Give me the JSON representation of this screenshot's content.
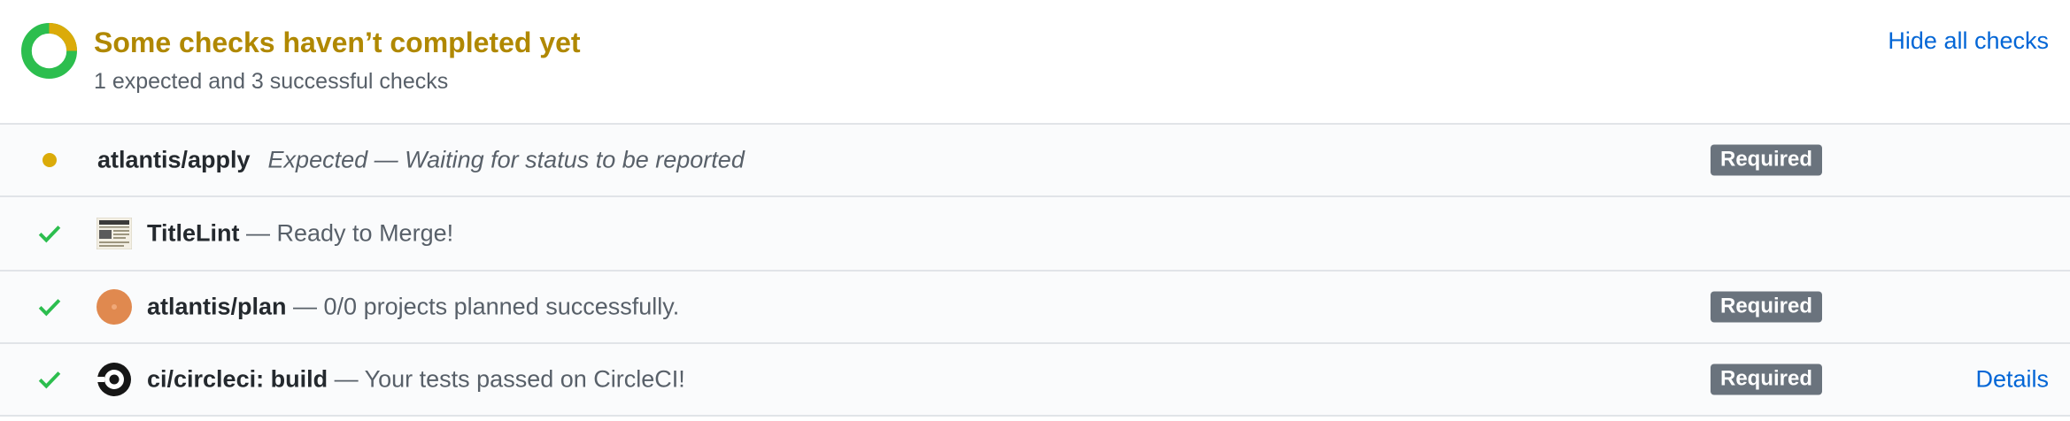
{
  "summary": {
    "title": "Some checks haven’t completed yet",
    "subtitle": "1 expected and 3 successful checks",
    "hide_label": "Hide all checks",
    "progress": {
      "completed": 3,
      "total": 4
    },
    "colors": {
      "pending": "#dbab09",
      "success": "#2cbe4e",
      "title": "#b08800",
      "link": "#0366d6"
    }
  },
  "checks": [
    {
      "name": "atlantis/apply",
      "description": "Expected — Waiting for status to be reported",
      "state": "pending",
      "icon": "pending-dot-icon",
      "required_label": "Required"
    },
    {
      "name": "TitleLint",
      "description": " — Ready to Merge!",
      "state": "success",
      "icon": "check-icon",
      "avatar": "titlelint-avatar"
    },
    {
      "name": "atlantis/plan",
      "description": " — 0/0 projects planned successfully.",
      "state": "success",
      "icon": "check-icon",
      "avatar": "atlantis-avatar",
      "required_label": "Required"
    },
    {
      "name": "ci/circleci: build",
      "description": " — Your tests passed on CircleCI!",
      "state": "success",
      "icon": "check-icon",
      "avatar": "circleci-logo",
      "required_label": "Required",
      "details_label": "Details"
    }
  ]
}
